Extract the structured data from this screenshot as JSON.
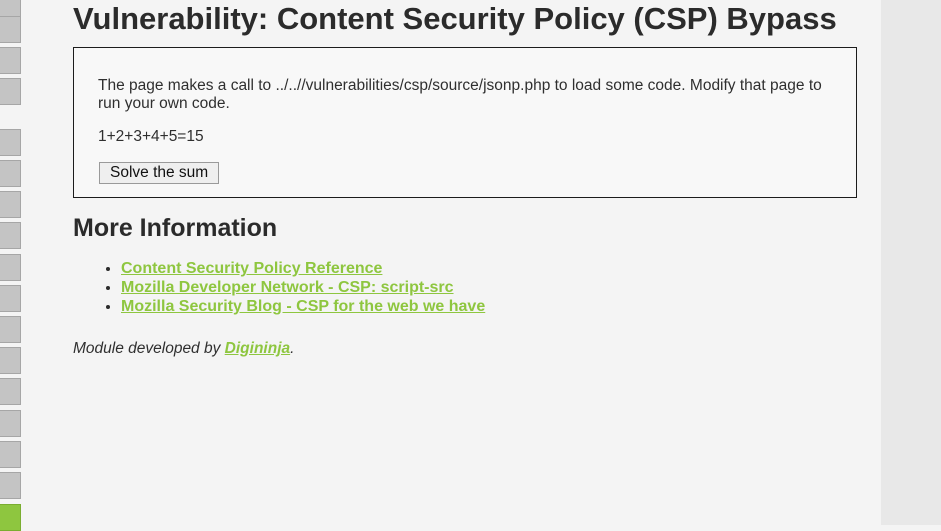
{
  "page": {
    "title": "Vulnerability: Content Security Policy (CSP) Bypass"
  },
  "vuln_box": {
    "description": "The page makes a call to ../..//vulnerabilities/csp/source/jsonp.php to load some code. Modify that page to run your own code.",
    "sum_text": "1+2+3+4+5=15",
    "solve_button_label": "Solve the sum"
  },
  "more_info": {
    "heading": "More Information",
    "links": [
      {
        "label": "Content Security Policy Reference"
      },
      {
        "label": "Mozilla Developer Network - CSP: script-src"
      },
      {
        "label": "Mozilla Security Blog - CSP for the web we have"
      }
    ]
  },
  "credit": {
    "prefix": "Module developed by ",
    "author": "Digininja",
    "suffix": "."
  },
  "colors": {
    "accent": "#8ec63f",
    "background": "#f4f4f4",
    "sidebar_button": "#c4c4c4"
  }
}
